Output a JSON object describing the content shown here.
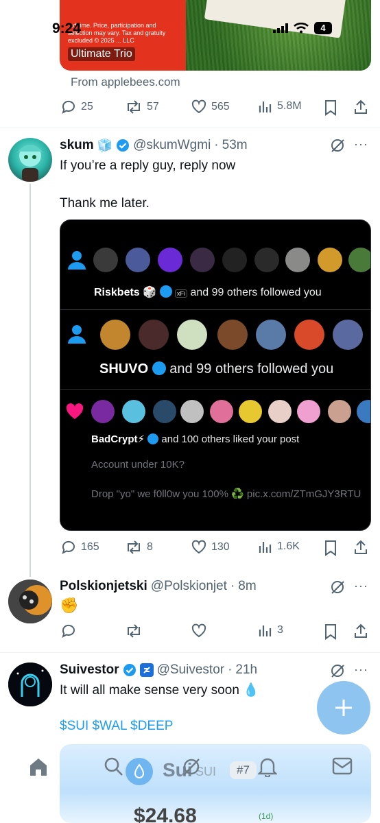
{
  "status_bar": {
    "time": "9:24",
    "battery": "4"
  },
  "ad": {
    "fine_print": "...d time. Price, participation and selection may vary. Tax and gratuity excluded © 2025 ... LLC",
    "button_label": "Ultimate Trio",
    "source": "From applebees.com",
    "actions": {
      "replies": "25",
      "reposts": "57",
      "likes": "565",
      "views": "5.8M"
    }
  },
  "post1": {
    "name": "skum",
    "name_emoji": "🧊",
    "handle": "@skumWgmi",
    "time": "53m",
    "text_line1": "If you’re a reply guy,  reply now",
    "text_line2": "Thank me later.",
    "media": {
      "row1_name": "Riskbets",
      "row1_text": "and 99 others followed you",
      "row1_badge": "xFi",
      "row2_name": "SHUVO",
      "row2_text": "and 99 others followed you",
      "row3_name": "BadCrypt⚡",
      "row3_text": "and 100 others liked your post",
      "line1": "Account under 10K?",
      "line2": "Drop \"yo\" we f0ll0w you 100% ♻️ pic.x.com/ZTmGJY3RTU"
    },
    "actions": {
      "replies": "165",
      "reposts": "8",
      "likes": "130",
      "views": "1.6K"
    }
  },
  "post2": {
    "name": "Polskionjetski",
    "handle": "@Polskionjet",
    "time": "8m",
    "text": "✊",
    "actions": {
      "views": "3"
    }
  },
  "post3": {
    "name": "Suivestor",
    "handle": "@Suivestor",
    "time": "21h",
    "text": "It will all make sense very soon 💧",
    "tags": "$SUI $WAL $DEEP"
  },
  "sui_ad": {
    "name": "Sui",
    "ticker": "SUI",
    "rank": "#7",
    "price": "$24.68",
    "period": "(1d)"
  },
  "colors": {
    "accent": "#1d9bf0",
    "gray": "#536471",
    "verified": "#1d9bf0"
  }
}
